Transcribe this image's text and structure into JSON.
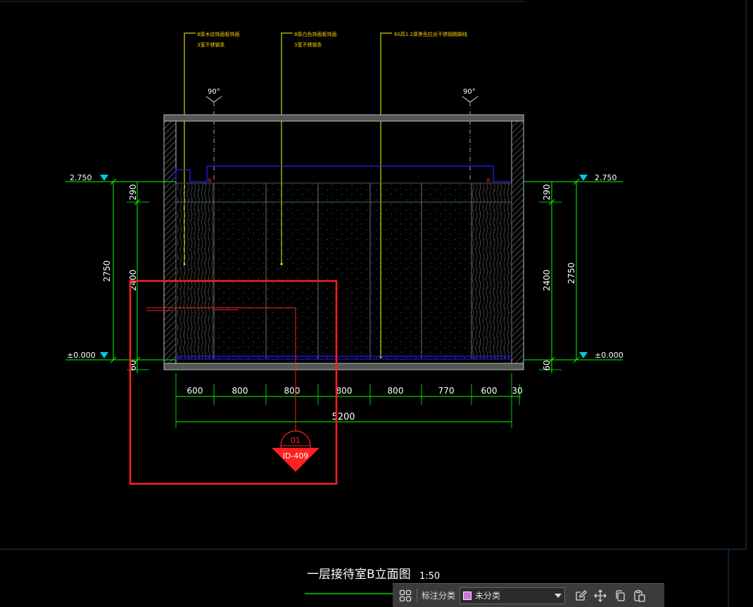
{
  "drawing": {
    "annotations": [
      {
        "line1": "8厚木纹饰面板饰面",
        "line2": "3宽不锈钢条"
      },
      {
        "line1": "8厚白色饰面板饰面",
        "line2": "3宽不锈钢条"
      },
      {
        "line1": "60高1.2厚黑色拉丝不锈钢踢脚线",
        "line2": ""
      }
    ],
    "angle_labels": [
      "90°",
      "90°"
    ],
    "levels": {
      "top": "2.750",
      "bottom": "±0.000"
    },
    "vertical_dims_left": [
      "290",
      "2750",
      "2400",
      "60"
    ],
    "vertical_dims_right": [
      "290",
      "2400",
      "2750",
      "60"
    ],
    "horizontal_dims": [
      "600",
      "800",
      "800",
      "800",
      "800",
      "770",
      "600",
      "30"
    ],
    "total_width": "5200",
    "detail_callout": {
      "number": "01",
      "sheet": "ID-409"
    },
    "title": "一层接待室B立面图",
    "scale": "1:50"
  },
  "toolbar": {
    "category_label": "标注分类",
    "selected_category": "未分类",
    "selected_color": "#d070e0"
  },
  "colors": {
    "annotation": "#ffff00",
    "dimension": "#00ff00",
    "outline": "#2020ff",
    "selection": "#ff2020",
    "level_marker": "#00c8e0"
  }
}
